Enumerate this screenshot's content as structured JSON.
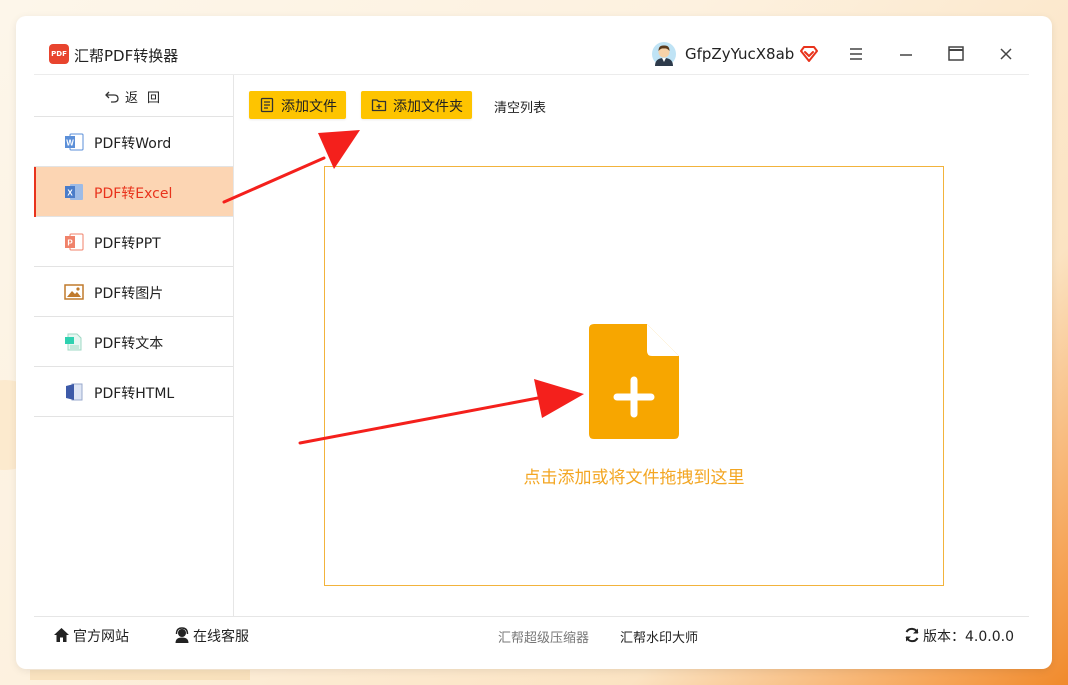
{
  "app": {
    "logo_text": "PDF",
    "title": "汇帮PDF转换器",
    "username": "GfpZyYucX8ab"
  },
  "sidebar": {
    "back_label": "返回",
    "items": [
      {
        "label": "PDF转Word",
        "icon": "word-icon",
        "active": false
      },
      {
        "label": "PDF转Excel",
        "icon": "excel-icon",
        "active": true
      },
      {
        "label": "PDF转PPT",
        "icon": "ppt-icon",
        "active": false
      },
      {
        "label": "PDF转图片",
        "icon": "image-icon",
        "active": false
      },
      {
        "label": "PDF转文本",
        "icon": "text-icon",
        "active": false
      },
      {
        "label": "PDF转HTML",
        "icon": "html-icon",
        "active": false
      }
    ]
  },
  "toolbar": {
    "add_file_label": "添加文件",
    "add_folder_label": "添加文件夹",
    "clear_list_label": "清空列表"
  },
  "dropzone": {
    "hint": "点击添加或将文件拖拽到这里"
  },
  "footer": {
    "official_site": "官方网站",
    "online_service": "在线客服",
    "promo_compressor": "汇帮超级压缩器",
    "promo_watermark": "汇帮水印大师",
    "version_label": "版本：4.0.0.0"
  },
  "colors": {
    "accent_yellow": "#fec400",
    "active_bg": "#fcd5b3",
    "active_text": "#e8331c",
    "drop_icon": "#f7a600",
    "annotation_red": "#f4201c"
  }
}
